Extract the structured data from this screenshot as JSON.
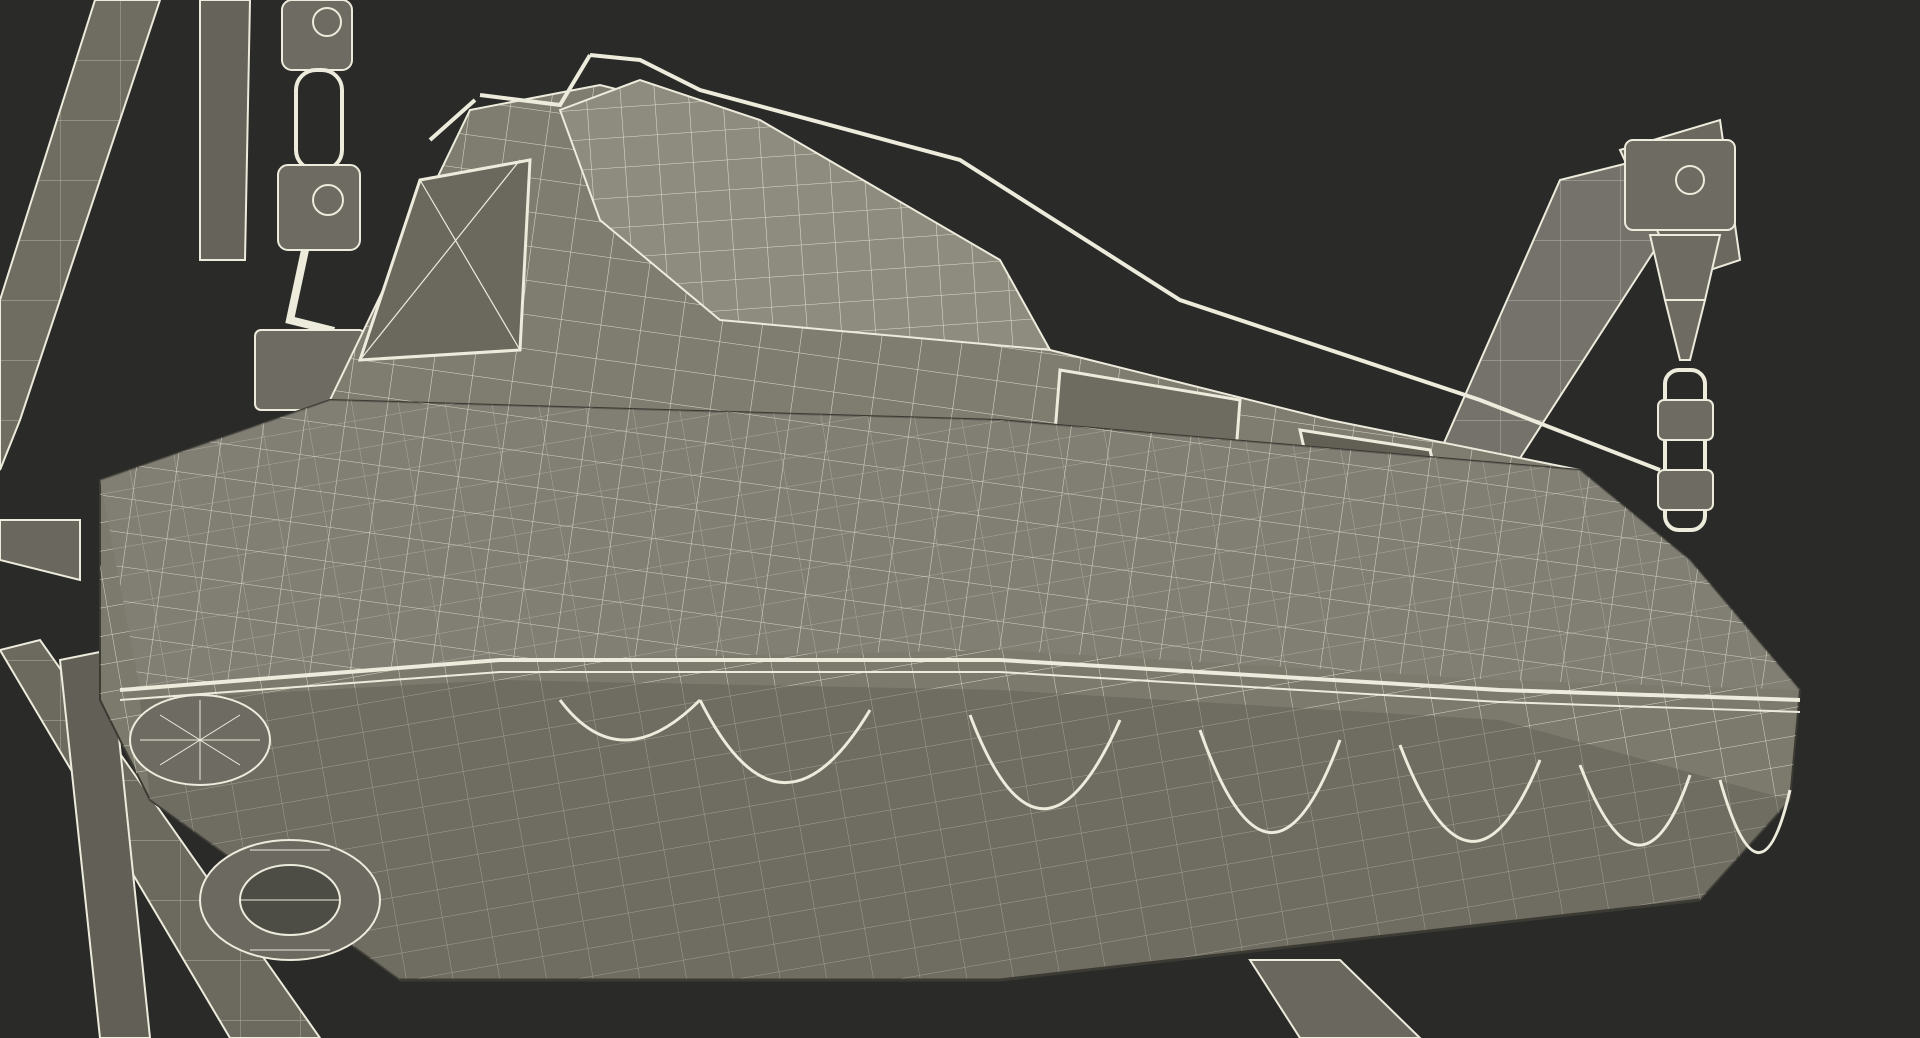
{
  "scene": {
    "subject": "lifeboat-davit-wireframe",
    "colors": {
      "background": "#2a2a28",
      "surface": "#7c7a6d",
      "surface_light": "#8e8c7e",
      "surface_dark": "#5f5e54",
      "wire": "#ecebdc",
      "edge": "#3b3a33"
    }
  }
}
